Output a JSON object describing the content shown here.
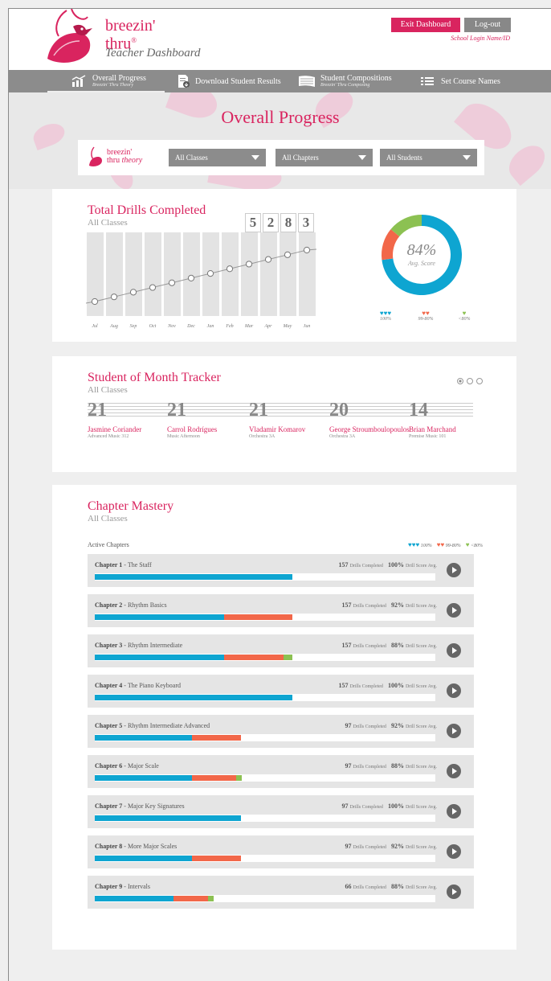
{
  "colors": {
    "brand": "#d9245f",
    "blue": "#0ea5d1",
    "red": "#f26749",
    "green": "#8cc152"
  },
  "header": {
    "logo_line1": "breezin'",
    "logo_line2": "thru",
    "logo_reg": "®",
    "subtitle": "Teacher Dashboard",
    "exit_label": "Exit Dashboard",
    "logout_label": "Log-out",
    "school_id": "School Login Name/ID"
  },
  "nav": [
    {
      "title": "Overall Progress",
      "sub": "Breezin' Thru Theory",
      "icon": "chart-icon"
    },
    {
      "title": "Download Student Results",
      "icon": "download-doc-icon"
    },
    {
      "title": "Student Compositions",
      "sub": "Breezin' Thru Composing",
      "icon": "score-icon"
    },
    {
      "title": "Set Course Names",
      "icon": "list-icon"
    }
  ],
  "page_title": "Overall Progress",
  "filters": {
    "brand_line1": "breezin'",
    "brand_line2": "thru",
    "brand_line3": "theory",
    "classes": "All Classes",
    "chapters": "All Chapters",
    "students": "All Students"
  },
  "drills": {
    "title": "Total Drills Completed",
    "sub": "All Classes",
    "digits": [
      "5",
      "2",
      "8",
      "3"
    ],
    "avg_value": "84%",
    "avg_label": "Avg. Score",
    "legend": [
      {
        "hearts": "♥♥♥",
        "label": "100%"
      },
      {
        "hearts": "♥♥",
        "label": "99-80%"
      },
      {
        "hearts": "♥",
        "label": "<80%"
      }
    ]
  },
  "chart_data": {
    "type": "line",
    "categories": [
      "Jul",
      "Aug",
      "Sep",
      "Oct",
      "Nov",
      "Dec",
      "Jan",
      "Feb",
      "Mar",
      "Apr",
      "May",
      "Jun"
    ],
    "values": [
      1,
      2,
      3,
      4,
      5,
      6,
      7,
      8,
      9,
      10,
      11,
      12
    ],
    "donut": {
      "blue": 73,
      "red": 13,
      "green": 14
    }
  },
  "tracker": {
    "title": "Student of Month Tracker",
    "sub": "All Classes",
    "students": [
      {
        "num": "21",
        "name": "Jasmine Coriander",
        "cls": "Advanced Music 312"
      },
      {
        "num": "21",
        "name": "Carrol Rodrígues",
        "cls": "Music Afternoon"
      },
      {
        "num": "21",
        "name": "Vladamir Komarov",
        "cls": "Orchestra 3A"
      },
      {
        "num": "20",
        "name": "George Stroumboulopoulos",
        "cls": "Orchestra 3A"
      },
      {
        "num": "14",
        "name": "Brian Marchand",
        "cls": "Premise Music 101"
      }
    ]
  },
  "mastery": {
    "title": "Chapter Mastery",
    "sub": "All Classes",
    "active_label": "Active Chapters",
    "legend": [
      {
        "hearts": "♥♥♥",
        "label": "100%"
      },
      {
        "hearts": "♥♥",
        "label": "99-80%"
      },
      {
        "hearts": "♥",
        "label": "<80%"
      }
    ],
    "drills_suffix": "Drills Completed",
    "score_suffix": "Drill Score Avg.",
    "chapters": [
      {
        "num": "Chapter 1",
        "name": "- The Staff",
        "drills": "157",
        "score": "100%",
        "blue": 0.58,
        "red": 0,
        "green": 0
      },
      {
        "num": "Chapter 2",
        "name": "- Rhythm Basics",
        "drills": "157",
        "score": "92%",
        "blue": 0.38,
        "red": 0.2,
        "green": 0
      },
      {
        "num": "Chapter 3",
        "name": "- Rhythm Intermediate",
        "drills": "157",
        "score": "88%",
        "blue": 0.38,
        "red": 0.175,
        "green": 0.025
      },
      {
        "num": "Chapter 4",
        "name": "- The Piano Keyboard",
        "drills": "157",
        "score": "100%",
        "blue": 0.58,
        "red": 0,
        "green": 0
      },
      {
        "num": "Chapter 5",
        "name": "- Rhythm Intermediate Advanced",
        "drills": "97",
        "score": "92%",
        "blue": 0.285,
        "red": 0.145,
        "green": 0
      },
      {
        "num": "Chapter 6",
        "name": "- Major Scale",
        "drills": "97",
        "score": "88%",
        "blue": 0.285,
        "red": 0.13,
        "green": 0.017
      },
      {
        "num": "Chapter 7",
        "name": "- Major Key Signatures",
        "drills": "97",
        "score": "100%",
        "blue": 0.43,
        "red": 0,
        "green": 0
      },
      {
        "num": "Chapter 8",
        "name": "- More Major Scales",
        "drills": "97",
        "score": "92%",
        "blue": 0.285,
        "red": 0.145,
        "green": 0
      },
      {
        "num": "Chapter 9",
        "name": "- Intervals",
        "drills": "66",
        "score": "88%",
        "blue": 0.23,
        "red": 0.102,
        "green": 0.016
      }
    ]
  }
}
